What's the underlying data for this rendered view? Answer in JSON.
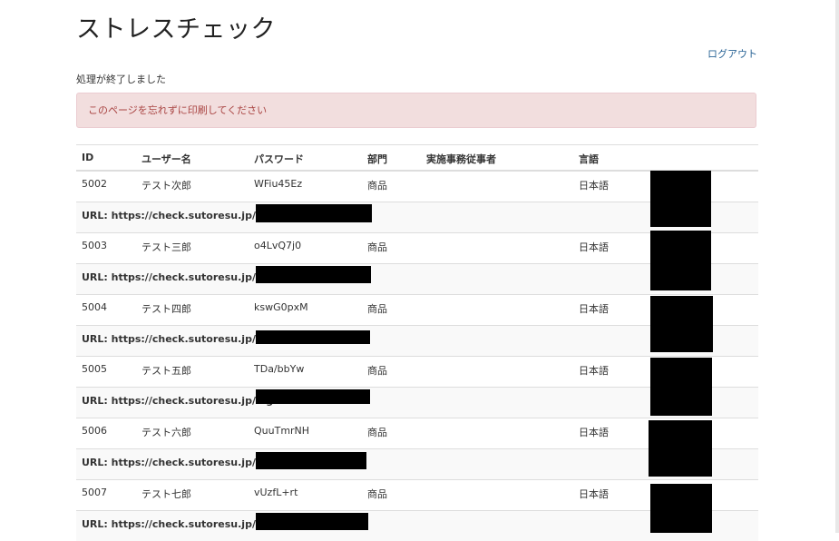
{
  "page": {
    "title": "ストレスチェック",
    "logout_label": "ログアウト",
    "status_message": "処理が終了しました",
    "alert_message": "このページを忘れずに印刷してください"
  },
  "table": {
    "headers": [
      "ID",
      "ユーザー名",
      "パスワード",
      "部門",
      "実施事務従事者",
      "言語"
    ],
    "url_label": "URL: https://check.sutoresu.jp/login",
    "rows": [
      {
        "id": "5002",
        "user": "テスト次郎",
        "password": "WFiu45Ez",
        "dept": "商品",
        "staff": "",
        "lang": "日本語"
      },
      {
        "id": "5003",
        "user": "テスト三郎",
        "password": "o4LvQ7j0",
        "dept": "商品",
        "staff": "",
        "lang": "日本語"
      },
      {
        "id": "5004",
        "user": "テスト四郎",
        "password": "kswG0pxM",
        "dept": "商品",
        "staff": "",
        "lang": "日本語"
      },
      {
        "id": "5005",
        "user": "テスト五郎",
        "password": "TDa/bbYw",
        "dept": "商品",
        "staff": "",
        "lang": "日本語"
      },
      {
        "id": "5006",
        "user": "テスト六郎",
        "password": "QuuTmrNH",
        "dept": "商品",
        "staff": "",
        "lang": "日本語"
      },
      {
        "id": "5007",
        "user": "テスト七郎",
        "password": "vUzfL+rt",
        "dept": "商品",
        "staff": "",
        "lang": "日本語"
      }
    ]
  },
  "colors": {
    "alert_bg": "#f2dede",
    "alert_text": "#a94442",
    "link": "#2a6496",
    "redaction": "#000000"
  }
}
